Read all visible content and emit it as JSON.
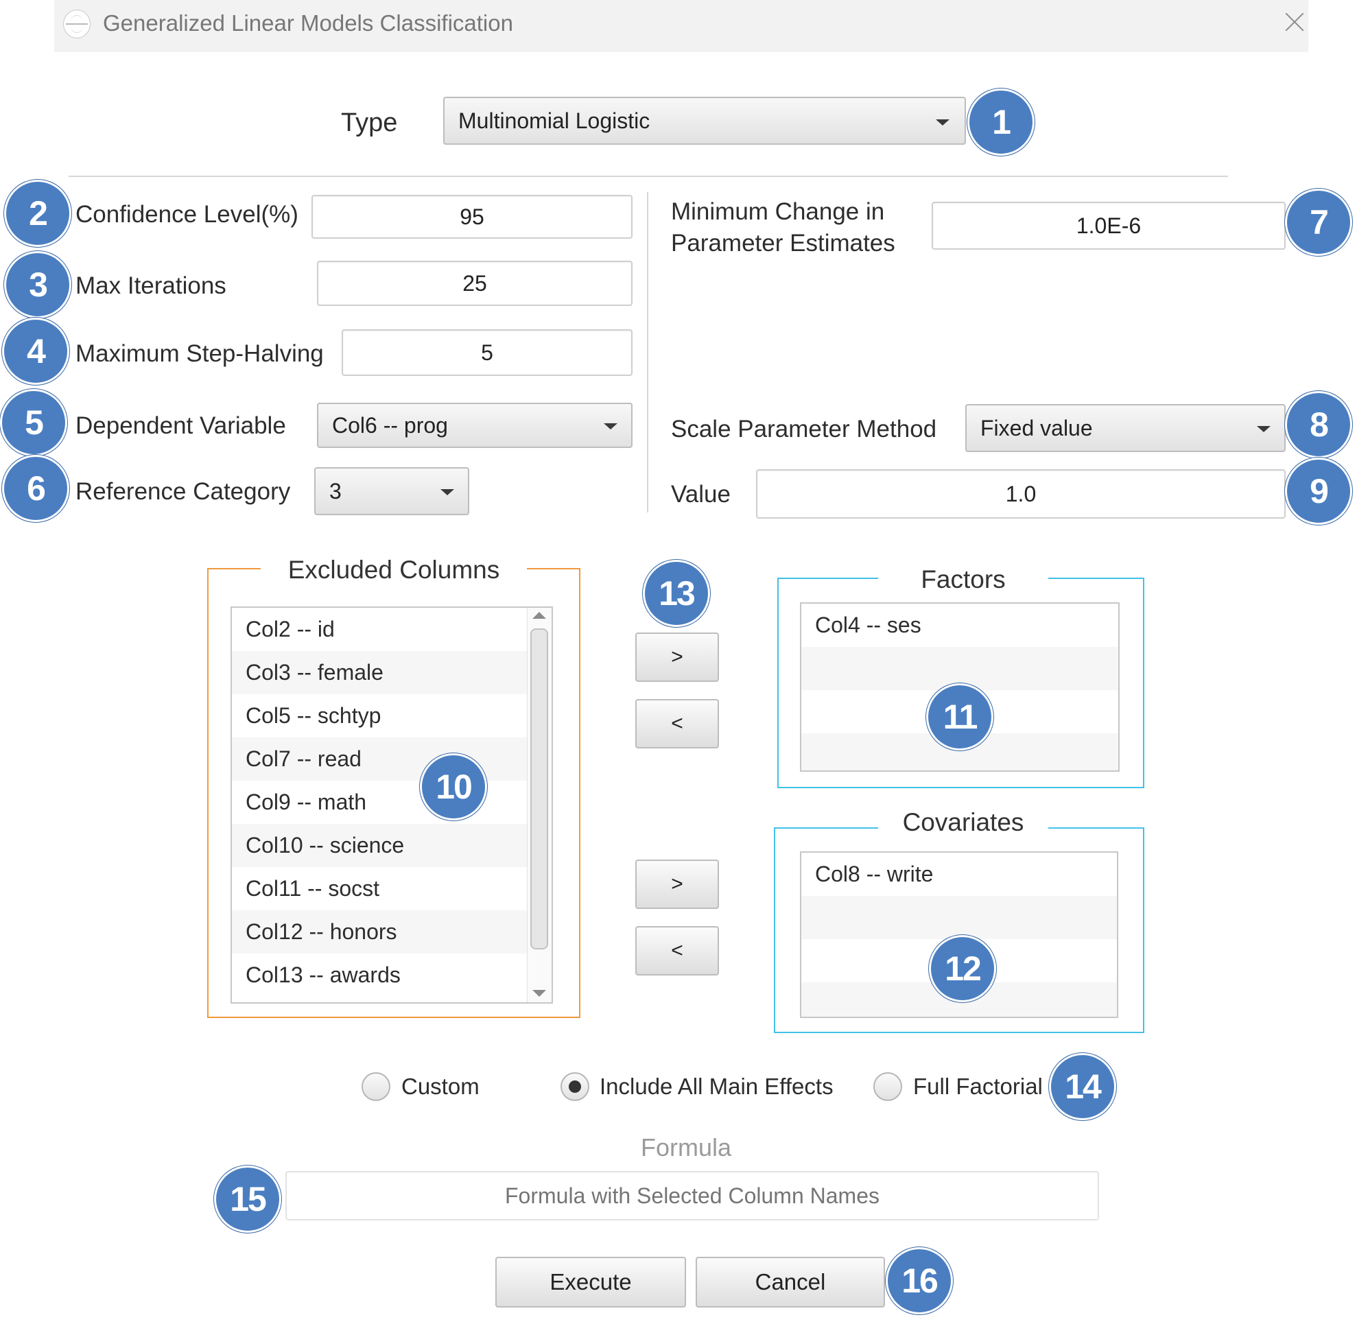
{
  "window": {
    "title": "Generalized Linear Models Classification",
    "close_icon": "close-icon"
  },
  "type": {
    "label": "Type",
    "value": "Multinomial Logistic"
  },
  "left": {
    "confidence_label": "Confidence Level(%)",
    "confidence_value": "95",
    "max_iterations_label": "Max Iterations",
    "max_iterations_value": "25",
    "step_halving_label": "Maximum Step-Halving",
    "step_halving_value": "5",
    "dependent_label": "Dependent Variable",
    "dependent_value": "Col6 -- prog",
    "reference_label": "Reference Category",
    "reference_value": "3"
  },
  "right": {
    "min_change_label_line1": "Minimum Change in",
    "min_change_label_line2": "Parameter Estimates",
    "min_change_value": "1.0E-6",
    "scale_method_label": "Scale Parameter Method",
    "scale_method_value": "Fixed value",
    "value_label": "Value",
    "value_value": "1.0"
  },
  "excluded": {
    "title": "Excluded Columns",
    "items": [
      "Col2 -- id",
      "Col3 -- female",
      "Col5 -- schtyp",
      "Col7 -- read",
      "Col9 -- math",
      "Col10 -- science",
      "Col11 -- socst",
      "Col12 -- honors",
      "Col13 -- awards"
    ]
  },
  "factors": {
    "title": "Factors",
    "items": [
      "Col4 -- ses",
      "",
      "",
      ""
    ]
  },
  "covariates": {
    "title": "Covariates",
    "items": [
      "Col8 -- write",
      "",
      "",
      ""
    ]
  },
  "transfer": {
    "factors_add": ">",
    "factors_remove": "<",
    "covariates_add": ">",
    "covariates_remove": "<"
  },
  "model": {
    "custom": "Custom",
    "main_effects": "Include All Main Effects",
    "full_factorial": "Full Factorial",
    "selected": "Include All Main Effects"
  },
  "formula": {
    "label": "Formula",
    "placeholder": "Formula with Selected Column Names",
    "value": ""
  },
  "actions": {
    "execute": "Execute",
    "cancel": "Cancel"
  },
  "callouts": [
    "1",
    "2",
    "3",
    "4",
    "5",
    "6",
    "7",
    "8",
    "9",
    "10",
    "11",
    "12",
    "13",
    "14",
    "15",
    "16"
  ],
  "colors": {
    "callout": "#4a7ec1",
    "excluded_border": "#ef9a3c",
    "target_border": "#41c1e8"
  }
}
